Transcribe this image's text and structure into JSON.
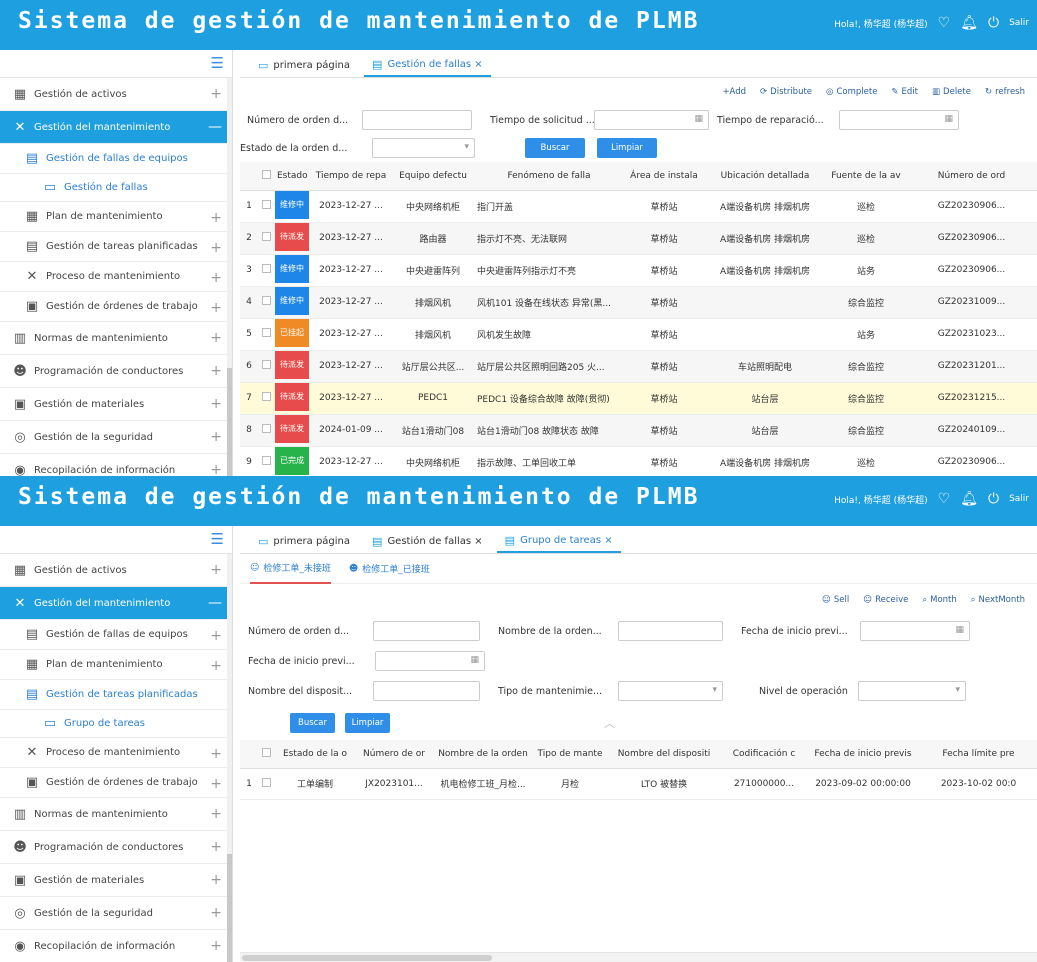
{
  "app_title": "Sistema de gestión de mantenimiento de PLMB",
  "header": {
    "user_text_1": "Hola!, 杨华超 (杨华超)",
    "user_text_2": "Hola!, 杨华超 (杨华超)",
    "logout_1": "Salir",
    "logout_2": "Salir"
  },
  "sidebar1": {
    "items": [
      {
        "label": "Gestión de activos"
      },
      {
        "label": "Gestión del mantenimiento"
      },
      {
        "label": "Gestión de fallas de equipos"
      },
      {
        "label": "Gestión de fallas"
      },
      {
        "label": "Plan de mantenimiento"
      },
      {
        "label": "Gestión de tareas planificadas"
      },
      {
        "label": "Proceso de mantenimiento"
      },
      {
        "label": "Gestión de órdenes de trabajo"
      },
      {
        "label": "Normas de mantenimiento"
      },
      {
        "label": "Programación de conductores"
      },
      {
        "label": "Gestión de materiales"
      },
      {
        "label": "Gestión de la seguridad"
      },
      {
        "label": "Recopilación de información"
      }
    ]
  },
  "sidebar2": {
    "items": [
      {
        "label": "Gestión de activos"
      },
      {
        "label": "Gestión del mantenimiento"
      },
      {
        "label": "Gestión de fallas de equipos"
      },
      {
        "label": "Plan de mantenimiento"
      },
      {
        "label": "Gestión de tareas planificadas"
      },
      {
        "label": "Grupo de tareas"
      },
      {
        "label": "Proceso de mantenimiento"
      },
      {
        "label": "Gestión de órdenes de trabajo"
      },
      {
        "label": "Normas de mantenimiento"
      },
      {
        "label": "Programación de conductores"
      },
      {
        "label": "Gestión de materiales"
      },
      {
        "label": "Gestión de la seguridad"
      },
      {
        "label": "Recopilación de información"
      }
    ]
  },
  "tabs1": [
    {
      "label": "primera página"
    },
    {
      "label": "Gestión de fallas ×"
    }
  ],
  "tabs2": [
    {
      "label": "primera página"
    },
    {
      "label": "Gestión de fallas ×"
    },
    {
      "label": "Grupo de tareas ×"
    }
  ],
  "toolbar1": {
    "add": "+Add",
    "distribute": "Distribute",
    "complete": "Complete",
    "edit": "Edit",
    "delete": "Delete",
    "refresh": "refresh"
  },
  "form1": {
    "order_no_label": "Número de orden d...",
    "request_time_label": "Tiempo de solicitud ...",
    "repair_time_label": "Tiempo de reparació...",
    "order_state_label": "Estado de la orden d...",
    "search_btn": "Buscar",
    "reset_btn": "Limpiar"
  },
  "table1": {
    "headers": [
      "Estado",
      "Tiempo de repa",
      "Equipo defectu",
      "Fenómeno de falla",
      "Área de instala",
      "Ubicación detallada",
      "Fuente de la av",
      "Número de ord"
    ],
    "rows": [
      {
        "n": "1",
        "status": "维修中",
        "time": "2023-12-27 ...",
        "equip": "中央网络机柜",
        "phen": "指门开盖",
        "area": "草桥站",
        "loc": "A端设备机房 排烟机房",
        "src": "巡检",
        "no": "GZ20230906..."
      },
      {
        "n": "2",
        "status": "待派发",
        "time": "2023-12-27 ...",
        "equip": "路由器",
        "phen": "指示灯不亮、无法联网",
        "area": "草桥站",
        "loc": "A端设备机房 排烟机房",
        "src": "巡检",
        "no": "GZ20230906..."
      },
      {
        "n": "3",
        "status": "维修中",
        "time": "2023-12-27 ...",
        "equip": "中央避雷阵列",
        "phen": "中央避雷阵列指示灯不亮",
        "area": "草桥站",
        "loc": "A端设备机房 排烟机房",
        "src": "站务",
        "no": "GZ20230906..."
      },
      {
        "n": "4",
        "status": "维修中",
        "time": "2023-12-27 ...",
        "equip": "排烟风机",
        "phen": "风机101 设备在线状态 异常(黑...",
        "area": "草桥站",
        "loc": "",
        "src": "综合监控",
        "no": "GZ20231009..."
      },
      {
        "n": "5",
        "status": "已挂起",
        "time": "2023-12-27 ...",
        "equip": "排烟风机",
        "phen": "风机发生故障",
        "area": "草桥站",
        "loc": "",
        "src": "站务",
        "no": "GZ20231023..."
      },
      {
        "n": "6",
        "status": "待派发",
        "time": "2023-12-27 ...",
        "equip": "站厅层公共区...",
        "phen": "站厅层公共区照明回路205 火...",
        "area": "草桥站",
        "loc": "车站照明配电",
        "src": "综合监控",
        "no": "GZ20231201..."
      },
      {
        "n": "7",
        "status": "待派发",
        "time": "2023-12-27 ...",
        "equip": "PEDC1",
        "phen": "PEDC1 设备综合故障 故障(贯彻)",
        "area": "草桥站",
        "loc": "站台层",
        "src": "综合监控",
        "no": "GZ20231215..."
      },
      {
        "n": "8",
        "status": "待派发",
        "time": "2024-01-09 ...",
        "equip": "站台1滑动门08",
        "phen": "站台1滑动门08 故障状态 故障",
        "area": "草桥站",
        "loc": "站台层",
        "src": "综合监控",
        "no": "GZ20240109..."
      },
      {
        "n": "9",
        "status": "已完成",
        "time": "2023-12-27 ...",
        "equip": "中央网络机柜",
        "phen": "指示故障、工单回收工单",
        "area": "草桥站",
        "loc": "A端设备机房 排烟机房",
        "src": "巡检",
        "no": "GZ20230906..."
      }
    ]
  },
  "subtabs2": [
    {
      "label": "检修工单_未接班"
    },
    {
      "label": "检修工单_已接班"
    }
  ],
  "toolbar2": {
    "sell": "Sell",
    "receive": "Receive",
    "month": "Month",
    "next_month": "NextMonth"
  },
  "form2": {
    "order_no_label": "Número de orden d...",
    "order_name_label": "Nombre de la orden...",
    "start_date_label": "Fecha de inicio previ...",
    "start_date_label_2": "Fecha de inicio previ...",
    "device_name_label": "Nombre del disposit...",
    "maint_type_label": "Tipo de mantenimie...",
    "op_level_label": "Nivel de operación",
    "search_btn": "Buscar",
    "reset_btn": "Limpiar"
  },
  "table2": {
    "headers": [
      "Estado de la o",
      "Número de or",
      "Nombre de la orden",
      "Tipo de mante",
      "Nombre del dispositi",
      "Codificación c",
      "Fecha de inicio previs",
      "Fecha límite pre"
    ],
    "rows": [
      {
        "n": "1",
        "state": "工单编制",
        "no": "JX2023101...",
        "name": "机电检修工班_月检...",
        "type": "月检",
        "device": "LTO 被替换",
        "code": "271000000...",
        "start": "2023-09-02 00:00:00",
        "end": "2023-10-02 00:0"
      }
    ]
  },
  "colors": {
    "header_blue": "#1e9fe0",
    "status_repair": "#1e86e8",
    "status_pending": "#e84b4b",
    "status_hold": "#f08a24",
    "status_done": "#27b24a"
  }
}
